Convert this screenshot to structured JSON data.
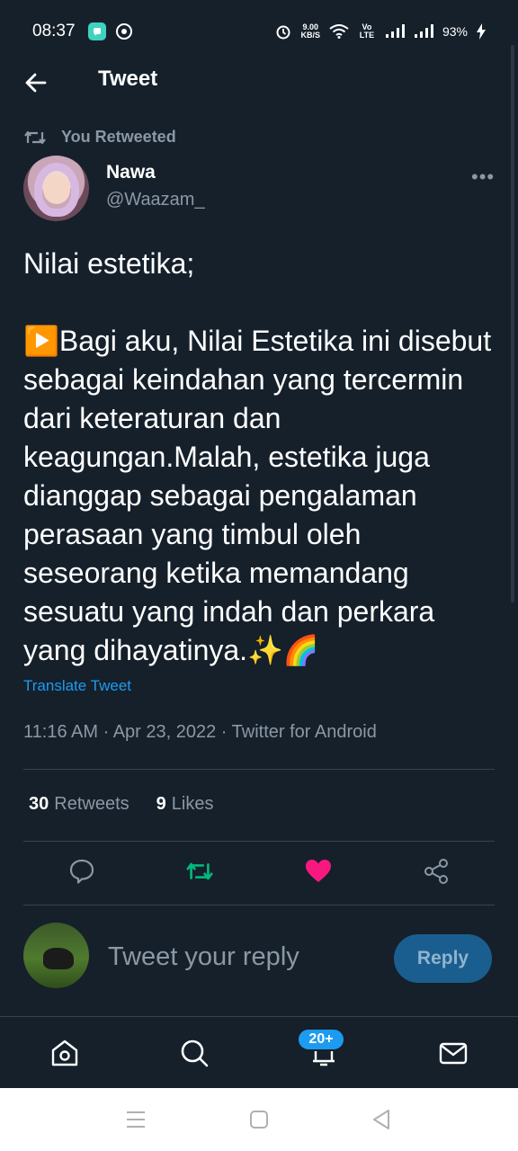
{
  "status_bar": {
    "time": "08:37",
    "network_speed_value": "9.00",
    "network_speed_unit": "KB/S",
    "volte_label": "Vo LTE",
    "battery": "93%"
  },
  "header": {
    "title": "Tweet"
  },
  "retweet": {
    "label": "You Retweeted"
  },
  "author": {
    "name": "Nawa",
    "handle": "@Waazam_"
  },
  "tweet": {
    "text": "Nilai estetika;\n\n▶️Bagi aku, Nilai Estetika ini disebut sebagai keindahan yang tercermin dari keteraturan dan keagungan.Malah, estetika juga dianggap sebagai pengalaman perasaan yang timbul oleh seseorang ketika memandang sesuatu yang indah dan perkara yang dihayatinya.✨🌈",
    "translate_label": "Translate Tweet",
    "meta": "11:16 AM · Apr 23, 2022 · Twitter for Android"
  },
  "stats": {
    "retweets_count": "30",
    "retweets_label": "Retweets",
    "likes_count": "9",
    "likes_label": "Likes"
  },
  "actions": {
    "reply_icon": "speech-bubble-icon",
    "retweet_icon": "retweet-icon",
    "like_icon": "heart-icon",
    "share_icon": "share-icon",
    "retweet_active_color": "#00ba7c",
    "like_active_color": "#f91880"
  },
  "reply": {
    "placeholder": "Tweet your reply",
    "button_label": "Reply"
  },
  "bottom_nav": {
    "notifications_badge": "20+"
  },
  "colors": {
    "background": "#15202b",
    "secondary_text": "#8b98a5",
    "accent": "#1d9bf0",
    "divider": "#38444d"
  }
}
